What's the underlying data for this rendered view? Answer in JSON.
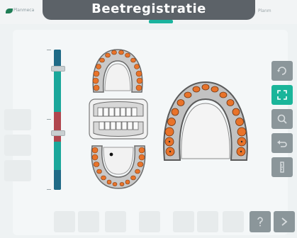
{
  "header": {
    "title": "Beetregistratie",
    "app_name": "Planmeca",
    "top_right_text": "Planm"
  },
  "colors": {
    "accent": "#1ab59a",
    "banner": "#5c6268",
    "slider_blue": "#1f6a86",
    "slider_teal": "#1aa79b",
    "slider_red": "#b0464e",
    "tooth_orange": "#e8732a"
  },
  "toolbar": {
    "items": [
      {
        "name": "rotate-icon",
        "active": false
      },
      {
        "name": "fit-view-icon",
        "active": true
      },
      {
        "name": "zoom-icon",
        "active": false
      },
      {
        "name": "undo-icon",
        "active": false
      },
      {
        "name": "ruler-icon",
        "active": false
      }
    ]
  },
  "bottom_bar": {
    "items": [
      {
        "name": "help-icon"
      },
      {
        "name": "next-icon"
      }
    ]
  }
}
